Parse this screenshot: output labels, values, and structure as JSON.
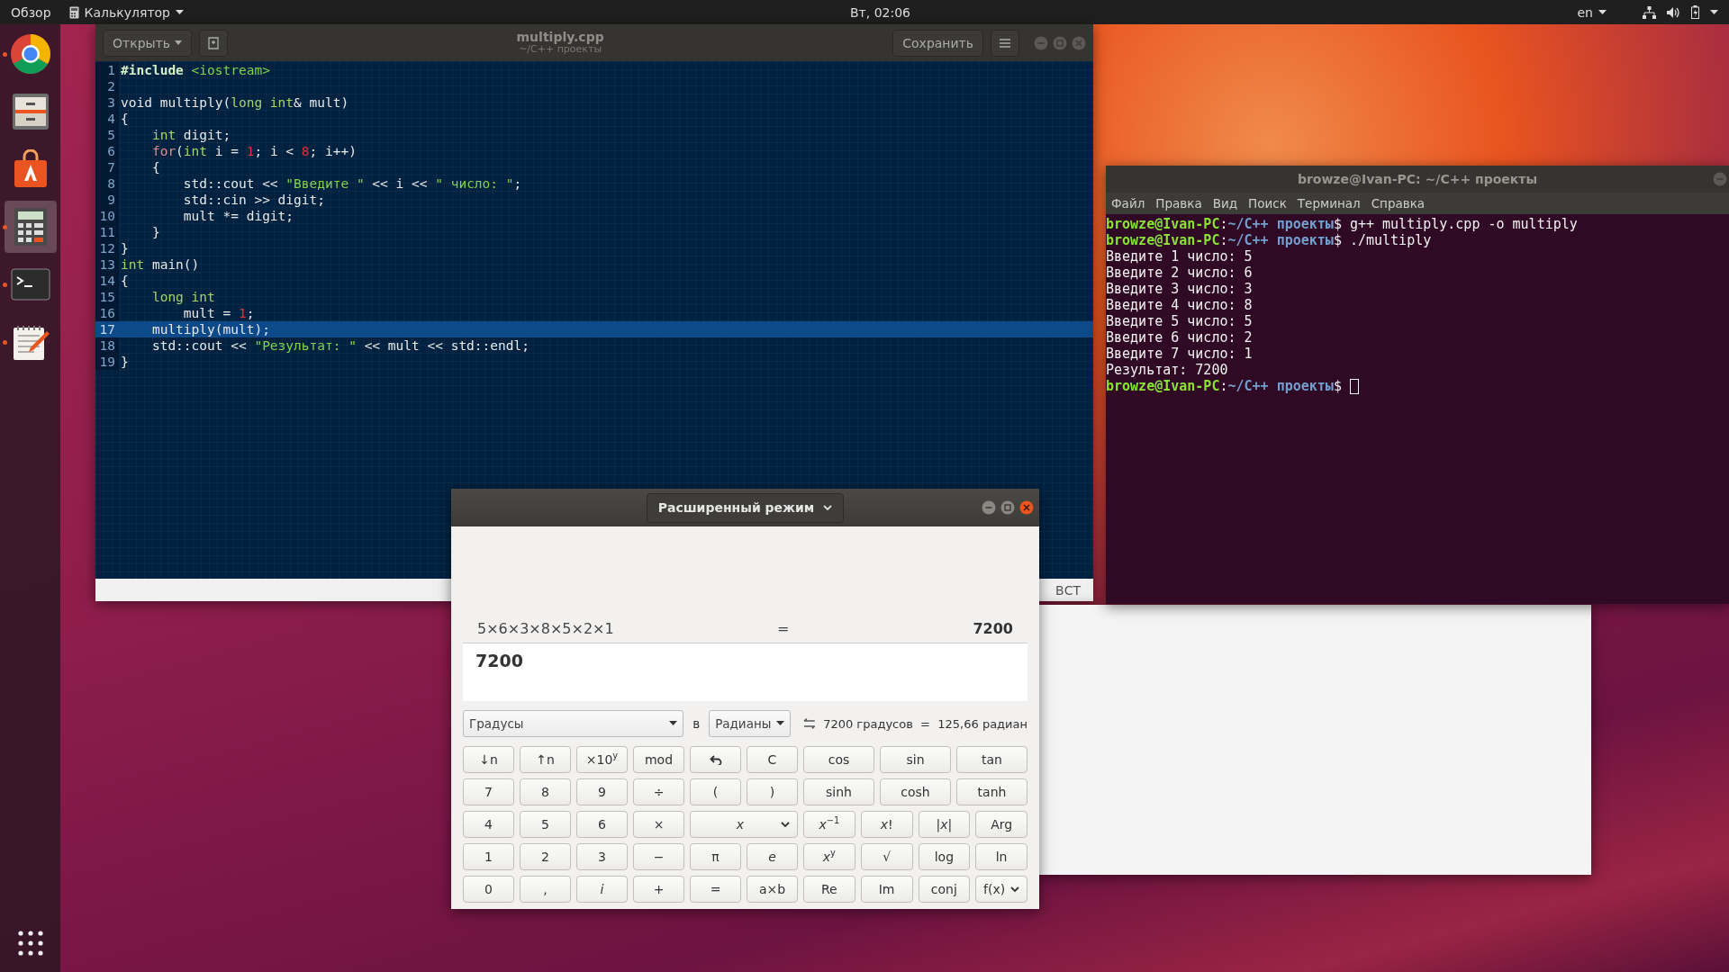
{
  "top_bar": {
    "activities": "Обзор",
    "app_menu": "Калькулятор",
    "clock": "Вт, 02:06",
    "keyboard_layout": "en"
  },
  "dock": {
    "apps": [
      {
        "kind": "browser",
        "running": true,
        "selected": false
      },
      {
        "kind": "files",
        "running": false,
        "selected": false
      },
      {
        "kind": "store",
        "running": false,
        "selected": false
      },
      {
        "kind": "calculator",
        "running": true,
        "selected": true
      },
      {
        "kind": "terminal",
        "running": true,
        "selected": false
      },
      {
        "kind": "editor",
        "running": true,
        "selected": false
      }
    ]
  },
  "editor": {
    "open_button": "Открыть",
    "title": "multiply.cpp",
    "subtitle": "~/C++ проекты",
    "save_button": "Сохранить",
    "status": "ВСТ",
    "lines": [
      {
        "number": "1",
        "current": false,
        "tokens": [
          {
            "text": "#include",
            "kind": "preproc"
          },
          {
            "text": " <iostream>",
            "kind": "string"
          }
        ]
      },
      {
        "number": "2",
        "current": false
      },
      {
        "number": "3",
        "current": false,
        "tokens": [
          {
            "text": "void multiply(",
            "kind": "plain"
          },
          {
            "text": "long int",
            "kind": "type"
          },
          {
            "text": "& mult)",
            "kind": "plain"
          }
        ]
      },
      {
        "number": "4",
        "current": false,
        "tokens": [
          {
            "text": "{",
            "kind": "plain"
          }
        ]
      },
      {
        "number": "5",
        "current": false,
        "tokens": [
          {
            "text": "    int",
            "kind": "type"
          },
          {
            "text": " digit;",
            "kind": "plain"
          }
        ]
      },
      {
        "number": "6",
        "current": false,
        "tokens": [
          {
            "text": "    for",
            "kind": "keyword"
          },
          {
            "text": "(",
            "kind": "plain"
          },
          {
            "text": "int",
            "kind": "type"
          },
          {
            "text": " i = ",
            "kind": "plain"
          },
          {
            "text": "1",
            "kind": "number"
          },
          {
            "text": "; i < ",
            "kind": "plain"
          },
          {
            "text": "8",
            "kind": "number"
          },
          {
            "text": "; i++)",
            "kind": "plain"
          }
        ]
      },
      {
        "number": "7",
        "current": false,
        "tokens": [
          {
            "text": "    {",
            "kind": "plain"
          }
        ]
      },
      {
        "number": "8",
        "current": false,
        "tokens": [
          {
            "text": "        std::cout << ",
            "kind": "plain"
          },
          {
            "text": "\"Введите \"",
            "kind": "string"
          },
          {
            "text": " << i << ",
            "kind": "plain"
          },
          {
            "text": "\" число: \"",
            "kind": "string"
          },
          {
            "text": ";",
            "kind": "plain"
          }
        ]
      },
      {
        "number": "9",
        "current": false,
        "tokens": [
          {
            "text": "        std::cin >> digit;",
            "kind": "plain"
          }
        ]
      },
      {
        "number": "10",
        "current": false,
        "tokens": [
          {
            "text": "        mult *= digit;",
            "kind": "plain"
          }
        ]
      },
      {
        "number": "11",
        "current": false,
        "tokens": [
          {
            "text": "    }",
            "kind": "plain"
          }
        ]
      },
      {
        "number": "12",
        "current": false,
        "tokens": [
          {
            "text": "}",
            "kind": "plain"
          }
        ]
      },
      {
        "number": "13",
        "current": false,
        "tokens": [
          {
            "text": "int",
            "kind": "type"
          },
          {
            "text": " main()",
            "kind": "plain"
          }
        ]
      },
      {
        "number": "14",
        "current": false,
        "tokens": [
          {
            "text": "{",
            "kind": "plain"
          }
        ]
      },
      {
        "number": "15",
        "current": false,
        "tokens": [
          {
            "text": "    long int",
            "kind": "type"
          }
        ]
      },
      {
        "number": "16",
        "current": false,
        "tokens": [
          {
            "text": "        mult = ",
            "kind": "plain"
          },
          {
            "text": "1",
            "kind": "number"
          },
          {
            "text": ";",
            "kind": "plain"
          }
        ]
      },
      {
        "number": "17",
        "current": true,
        "tokens": [
          {
            "text": "    multiply(mult);",
            "kind": "plain"
          }
        ]
      },
      {
        "number": "18",
        "current": false,
        "tokens": [
          {
            "text": "    std::cout << ",
            "kind": "plain"
          },
          {
            "text": "\"Результат: \"",
            "kind": "string"
          },
          {
            "text": " << mult << std::endl;",
            "kind": "plain"
          }
        ]
      },
      {
        "number": "19",
        "current": false,
        "tokens": [
          {
            "text": "}",
            "kind": "plain"
          }
        ]
      }
    ]
  },
  "terminal": {
    "title": "browze@Ivan-PC: ~/C++ проекты",
    "menu": [
      "Файл",
      "Правка",
      "Вид",
      "Поиск",
      "Терминал",
      "Справка"
    ],
    "cursor_visible": true,
    "lines": [
      [
        {
          "text": "browze@Ivan-PC",
          "kind": "user"
        },
        {
          "text": ":",
          "kind": "plain"
        },
        {
          "text": "~/C++ проекты",
          "kind": "path"
        },
        {
          "text": "$ g++ multiply.cpp -o multiply",
          "kind": "plain"
        }
      ],
      [
        {
          "text": "browze@Ivan-PC",
          "kind": "user"
        },
        {
          "text": ":",
          "kind": "plain"
        },
        {
          "text": "~/C++ проекты",
          "kind": "path"
        },
        {
          "text": "$ ./multiply",
          "kind": "plain"
        }
      ],
      [
        {
          "text": "Введите 1 число: 5",
          "kind": "plain"
        }
      ],
      [
        {
          "text": "Введите 2 число: 6",
          "kind": "plain"
        }
      ],
      [
        {
          "text": "Введите 3 число: 3",
          "kind": "plain"
        }
      ],
      [
        {
          "text": "Введите 4 число: 8",
          "kind": "plain"
        }
      ],
      [
        {
          "text": "Введите 5 число: 5",
          "kind": "plain"
        }
      ],
      [
        {
          "text": "Введите 6 число: 2",
          "kind": "plain"
        }
      ],
      [
        {
          "text": "Введите 7 число: 1",
          "kind": "plain"
        }
      ],
      [
        {
          "text": "Результат: 7200",
          "kind": "plain"
        }
      ],
      [
        {
          "text": "browze@Ivan-PC",
          "kind": "user"
        },
        {
          "text": ":",
          "kind": "plain"
        },
        {
          "text": "~/C++ проекты",
          "kind": "path"
        },
        {
          "text": "$ ",
          "kind": "plain"
        }
      ]
    ]
  },
  "calculator": {
    "mode": "Расширенный режим",
    "history": {
      "expression": "5×6×3×8×5×2×1",
      "equals": "=",
      "result": "7200"
    },
    "input": "7200",
    "conversion": {
      "from": "Градусы",
      "word": "в",
      "to": "Радианы",
      "result": "7200 градусов  =  125,66 радиан"
    },
    "basic_keys": [
      [
        {
          "label": "↓n",
          "kind": "key"
        },
        {
          "label": "↑n",
          "kind": "key"
        },
        {
          "label": "×10$^{y}$",
          "kind": "key"
        },
        {
          "label": "mod",
          "kind": "key"
        },
        {
          "kind": "undo"
        },
        {
          "label": "C",
          "kind": "key"
        }
      ],
      [
        {
          "label": "7",
          "kind": "key"
        },
        {
          "label": "8",
          "kind": "key"
        },
        {
          "label": "9",
          "kind": "key"
        },
        {
          "label": "÷",
          "kind": "key"
        },
        {
          "label": "(",
          "kind": "key"
        },
        {
          "label": ")",
          "kind": "key"
        }
      ],
      [
        {
          "label": "4",
          "kind": "key"
        },
        {
          "label": "5",
          "kind": "key"
        },
        {
          "label": "6",
          "kind": "key"
        },
        {
          "label": "×",
          "kind": "key"
        },
        {
          "label": "x",
          "kind": "variable-menu"
        }
      ],
      [
        {
          "label": "1",
          "kind": "key"
        },
        {
          "label": "2",
          "kind": "key"
        },
        {
          "label": "3",
          "kind": "key"
        },
        {
          "label": "−",
          "kind": "key"
        },
        {
          "label": "π",
          "kind": "key"
        },
        {
          "label": "e",
          "kind": "italic"
        }
      ],
      [
        {
          "label": "0",
          "kind": "key"
        },
        {
          "label": ",",
          "kind": "key"
        },
        {
          "label": "i",
          "kind": "italic"
        },
        {
          "label": "+",
          "kind": "key"
        },
        {
          "label": "=",
          "kind": "key"
        },
        {
          "label": "a×b",
          "kind": "key"
        }
      ]
    ],
    "trig_keys": [
      [
        {
          "label": "cos",
          "kind": "key"
        },
        {
          "label": "sin",
          "kind": "key"
        },
        {
          "label": "tan",
          "kind": "key"
        }
      ],
      [
        {
          "label": "sinh",
          "kind": "key"
        },
        {
          "label": "cosh",
          "kind": "key"
        },
        {
          "label": "tanh",
          "kind": "key"
        }
      ]
    ],
    "function_keys": [
      [
        {
          "label": "*x*$^{−1}$",
          "kind": "key"
        },
        {
          "label": "*x*!",
          "kind": "key"
        },
        {
          "label": "|*x*|",
          "kind": "key"
        },
        {
          "label": "Arg",
          "kind": "key"
        }
      ],
      [
        {
          "label": "*x*$^{y}$",
          "kind": "key"
        },
        {
          "label": "√",
          "kind": "key"
        },
        {
          "label": "log",
          "kind": "key"
        },
        {
          "label": "ln",
          "kind": "key"
        }
      ],
      [
        {
          "label": "Re",
          "kind": "key"
        },
        {
          "label": "Im",
          "kind": "key"
        },
        {
          "label": "conj",
          "kind": "key"
        },
        {
          "label": "f(x)",
          "kind": "menu"
        }
      ]
    ]
  }
}
